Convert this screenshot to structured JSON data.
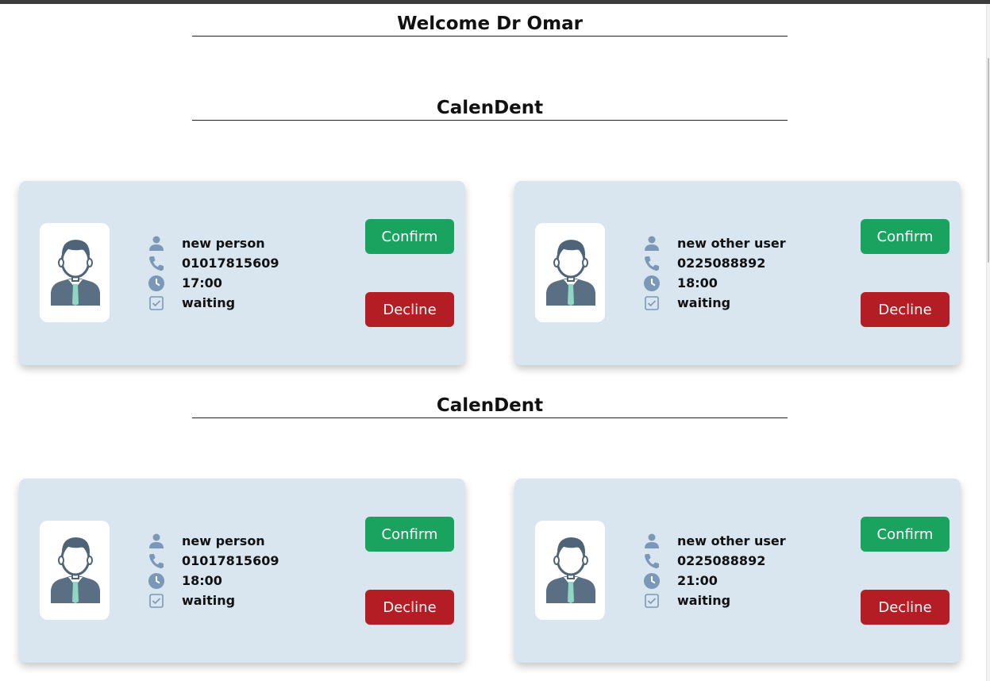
{
  "welcome": "Welcome Dr Omar",
  "sections": [
    {
      "title": "CalenDent",
      "cards": [
        {
          "name": "new person",
          "phone": "01017815609",
          "time": "17:00",
          "status": "waiting",
          "confirm_label": "Confirm",
          "decline_label": "Decline"
        },
        {
          "name": "new other user",
          "phone": "0225088892",
          "time": "18:00",
          "status": "waiting",
          "confirm_label": "Confirm",
          "decline_label": "Decline"
        }
      ]
    },
    {
      "title": "CalenDent",
      "cards": [
        {
          "name": "new person",
          "phone": "01017815609",
          "time": "18:00",
          "status": "waiting",
          "confirm_label": "Confirm",
          "decline_label": "Decline"
        },
        {
          "name": "new other user",
          "phone": "0225088892",
          "time": "21:00",
          "status": "waiting",
          "confirm_label": "Confirm",
          "decline_label": "Decline"
        }
      ]
    }
  ],
  "colors": {
    "card_background": "#d9e6f0",
    "confirm": "#1aa35f",
    "decline": "#b51d24",
    "icon": "#7b98b8",
    "avatar_hair": "#4f6478",
    "avatar_tie": "#8fd6c4"
  },
  "icons": {
    "name": "user-icon",
    "phone": "phone-icon",
    "time": "clock-icon",
    "status": "checkbox-icon"
  }
}
